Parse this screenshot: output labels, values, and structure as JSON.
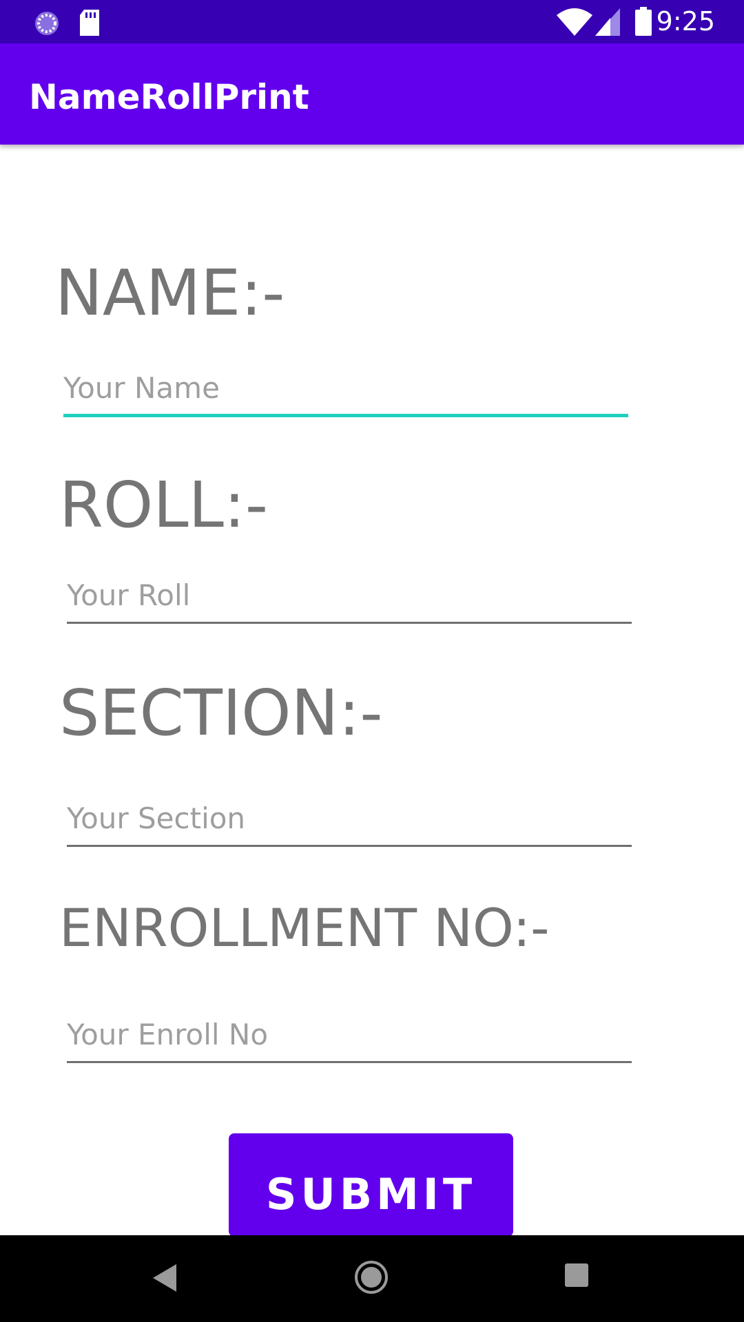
{
  "status_bar": {
    "time": "9:25",
    "icons": [
      "sync-icon",
      "sd-card-icon",
      "wifi-icon",
      "signal-icon",
      "battery-icon"
    ]
  },
  "app_bar": {
    "title": "NameRollPrint"
  },
  "form": {
    "name_label": "NAME:-",
    "name_placeholder": "Your Name",
    "roll_label": "ROLL:-",
    "roll_placeholder": "Your Roll",
    "section_label": "SECTION:-",
    "section_placeholder": "Your Section",
    "enroll_label": "ENROLLMENT NO:-",
    "enroll_placeholder": "Your Enroll No",
    "submit_label": "SUBMIT"
  },
  "nav_bar": {
    "icons": [
      "back-icon",
      "home-icon",
      "recents-icon"
    ]
  },
  "colors": {
    "status_bar": "#3700b3",
    "primary": "#6200ee",
    "focus_underline": "#1fd0bd",
    "label_text": "#757575"
  }
}
